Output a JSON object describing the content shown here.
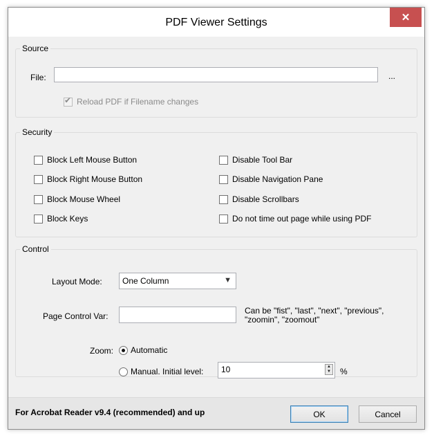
{
  "window": {
    "title": "PDF Viewer Settings",
    "close_icon": "close-icon",
    "close_color": "#c75050"
  },
  "source": {
    "legend": "Source",
    "file_label": "File:",
    "file_value": "",
    "browse_label": "...",
    "reload_label": "Reload PDF if Filename changes",
    "reload_checked": true,
    "reload_enabled": false
  },
  "security": {
    "legend": "Security",
    "left": [
      {
        "label": "Block Left Mouse Button",
        "checked": false
      },
      {
        "label": "Block Right Mouse Button",
        "checked": false
      },
      {
        "label": "Block Mouse Wheel",
        "checked": false
      },
      {
        "label": "Block Keys",
        "checked": false
      }
    ],
    "right": [
      {
        "label": "Disable Tool Bar",
        "checked": false
      },
      {
        "label": "Disable Navigation Pane",
        "checked": false
      },
      {
        "label": "Disable Scrollbars",
        "checked": false
      },
      {
        "label": "Do not time out page while using PDF",
        "checked": false
      }
    ]
  },
  "control": {
    "legend": "Control",
    "layout_label": "Layout Mode:",
    "layout_value": "One Column",
    "page_var_label": "Page Control Var:",
    "page_var_value": "",
    "page_var_hint": "Can be \"fist\", \"last\", \"next\", \"previous\", \"zoomin\", \"zoomout\"",
    "zoom_label": "Zoom:",
    "zoom_automatic": "Automatic",
    "zoom_manual": "Manual. Initial level:",
    "zoom_selected": "Automatic",
    "zoom_level": "10",
    "zoom_unit": "%"
  },
  "footer": {
    "note": "For Acrobat Reader v9.4 (recommended) and up",
    "ok_label": "OK",
    "cancel_label": "Cancel"
  }
}
